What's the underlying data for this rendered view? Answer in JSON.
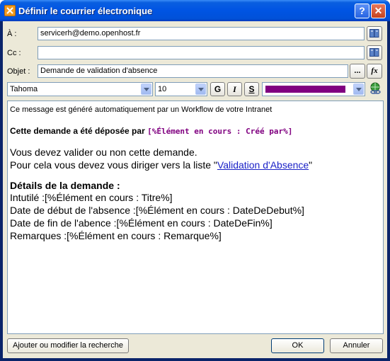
{
  "window": {
    "title": "Définir le courrier électronique"
  },
  "titlebar": {
    "help_label": "?",
    "close_label": "✕"
  },
  "fields": {
    "to_label": "À :",
    "to_value": "servicerh@demo.openhost.fr",
    "cc_label": "Cc :",
    "cc_value": "",
    "subject_label": "Objet :",
    "subject_value": "Demande de validation d'absence",
    "ellipsis_label": "...",
    "fx_label": "fx"
  },
  "toolbar": {
    "font": "Tahoma",
    "size": "10",
    "bold": "G",
    "italic": "I",
    "underline": "S",
    "text_color": "#800080"
  },
  "body": {
    "line1": "Ce message est généré automatiquement par un Workflow de votre Intranet",
    "line2_text": "Cette demande a été déposée par ",
    "line2_token": "[%Élément en cours : Créé par%]",
    "line3": "Vous devez valider ou non cette demande.",
    "line4_pre": "Pour cela vous devez vous diriger vers la liste \"",
    "line4_link": "Validation d'Absence",
    "line4_post": "\"",
    "details_title": "Détails de la demande :",
    "detail1": "Intutilé :[%Élément en cours : Titre%]",
    "detail2": "Date de début de l'absence :[%Élément en cours : DateDeDebut%]",
    "detail3": "Date de fin de l'abence :[%Élément en cours : DateDeFin%]",
    "detail4": "Remarques :[%Élément en cours : Remarque%]"
  },
  "buttons": {
    "lookup": "Ajouter ou modifier la recherche",
    "ok": "OK",
    "cancel": "Annuler"
  }
}
